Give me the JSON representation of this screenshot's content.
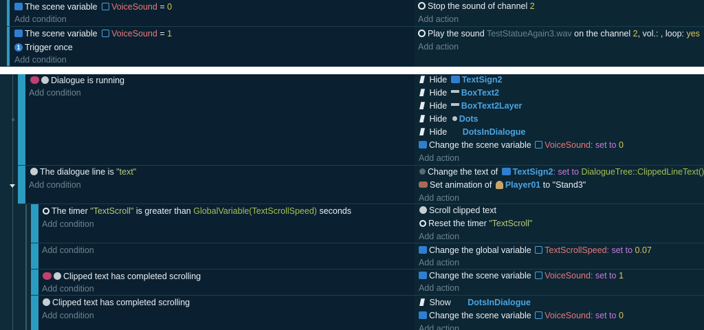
{
  "top": {
    "e1": {
      "cond": {
        "pre": "The scene variable",
        "var": "VoiceSound",
        "op": "=",
        "val": "0"
      },
      "add_condition": "Add condition",
      "action": {
        "pre": "Stop the sound of channel",
        "val": "2"
      },
      "add_action": "Add action"
    },
    "e2": {
      "cond": {
        "pre": "The scene variable",
        "var": "VoiceSound",
        "op": "=",
        "val": "1"
      },
      "cond2": "Trigger once",
      "add_condition": "Add condition",
      "action": {
        "pre": "Play the sound",
        "file": "TestStatueAgain3.wav",
        "mid": "on the channel",
        "chan": "2",
        "vol": ", vol.: , loop:",
        "loop": "yes"
      },
      "add_action": "Add action"
    }
  },
  "bottom": {
    "e3": {
      "cond": "Dialogue is running",
      "add_condition": "Add condition",
      "actions": [
        {
          "verb": "Hide",
          "obj": "TextSign2"
        },
        {
          "verb": "Hide",
          "obj": "BoxText2"
        },
        {
          "verb": "Hide",
          "obj": "BoxText2Layer"
        },
        {
          "verb": "Hide",
          "obj": "Dots"
        },
        {
          "verb": "Hide",
          "obj": "DotsInDialogue"
        }
      ],
      "setvar": {
        "pre": "Change the scene variable",
        "var": "VoiceSound",
        "op": ": set to",
        "val": "0"
      },
      "add_action": "Add action"
    },
    "e4": {
      "cond": {
        "pre": "The dialogue line is",
        "str": "\"text\""
      },
      "add_condition": "Add condition",
      "a1": {
        "pre": "Change the text of",
        "obj": "TextSign2",
        "op": ": set to",
        "fn": "DialogueTree::ClippedLineText()"
      },
      "a2": {
        "pre": "Set animation of",
        "obj": "Player01",
        "mid": "to",
        "str": "\"Stand3\""
      },
      "add_action": "Add action"
    },
    "e5": {
      "cond": {
        "pre": "The timer",
        "str": "\"TextScroll\"",
        "mid": "is greater than",
        "fn": "GlobalVariable(TextScrollSpeed)",
        "post": "seconds"
      },
      "add_condition": "Add condition",
      "a1": "Scroll clipped text",
      "a2": {
        "pre": "Reset the timer",
        "str": "\"TextScroll\""
      },
      "add_action": "Add action"
    },
    "e6": {
      "add_condition": "Add condition",
      "a1": {
        "pre": "Change the global variable",
        "var": "TextScrollSpeed",
        "op": ": set to",
        "val": "0.07"
      },
      "add_action": "Add action"
    },
    "e7": {
      "cond": "Clipped text has completed scrolling",
      "add_condition": "Add condition",
      "a1": {
        "pre": "Change the scene variable",
        "var": "VoiceSound",
        "op": ": set to",
        "val": "1"
      },
      "add_action": "Add action"
    },
    "e8": {
      "cond": "Clipped text has completed scrolling",
      "add_condition": "Add condition",
      "a1": {
        "verb": "Show",
        "obj": "DotsInDialogue"
      },
      "a2": {
        "pre": "Change the scene variable",
        "var": "VoiceSound",
        "op": ": set to",
        "val": "0"
      },
      "add_action": "Add action"
    }
  }
}
